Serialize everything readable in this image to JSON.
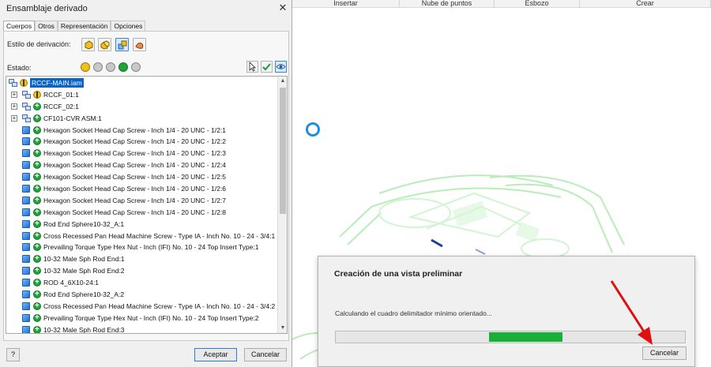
{
  "ribbon": {
    "tabs": [
      "Insertar",
      "Nube de puntos",
      "Esbozo",
      "Crear"
    ]
  },
  "dialog": {
    "title": "Ensamblaje derivado",
    "close_glyph": "✕",
    "tabs": [
      "Cuerpos",
      "Otros",
      "Representación",
      "Opciones"
    ],
    "active_tab": "Cuerpos",
    "derivation_style_label": "Estilo de derivación:",
    "state_label": "Estado:",
    "tree": [
      {
        "name": "RCCF-MAIN.iam",
        "status": "yellow",
        "type": "assembly",
        "level": 0,
        "expander": false,
        "selected": true
      },
      {
        "name": "RCCF_01:1",
        "status": "yellow",
        "type": "assembly",
        "level": 1,
        "expander": true,
        "selected": false
      },
      {
        "name": "RCCF_02:1",
        "status": "green",
        "type": "assembly",
        "level": 1,
        "expander": true,
        "selected": false
      },
      {
        "name": "CF101-CVR ASM:1",
        "status": "green",
        "type": "assembly",
        "level": 1,
        "expander": true,
        "selected": false
      },
      {
        "name": "Hexagon Socket Head Cap Screw - Inch 1/4 - 20 UNC - 1/2:1",
        "status": "green",
        "type": "part",
        "level": 1,
        "expander": false,
        "selected": false
      },
      {
        "name": "Hexagon Socket Head Cap Screw - Inch 1/4 - 20 UNC - 1/2:2",
        "status": "green",
        "type": "part",
        "level": 1,
        "expander": false,
        "selected": false
      },
      {
        "name": "Hexagon Socket Head Cap Screw - Inch 1/4 - 20 UNC - 1/2:3",
        "status": "green",
        "type": "part",
        "level": 1,
        "expander": false,
        "selected": false
      },
      {
        "name": "Hexagon Socket Head Cap Screw - Inch 1/4 - 20 UNC - 1/2:4",
        "status": "green",
        "type": "part",
        "level": 1,
        "expander": false,
        "selected": false
      },
      {
        "name": "Hexagon Socket Head Cap Screw - Inch 1/4 - 20 UNC - 1/2:5",
        "status": "green",
        "type": "part",
        "level": 1,
        "expander": false,
        "selected": false
      },
      {
        "name": "Hexagon Socket Head Cap Screw - Inch 1/4 - 20 UNC - 1/2:6",
        "status": "green",
        "type": "part",
        "level": 1,
        "expander": false,
        "selected": false
      },
      {
        "name": "Hexagon Socket Head Cap Screw - Inch 1/4 - 20 UNC - 1/2:7",
        "status": "green",
        "type": "part",
        "level": 1,
        "expander": false,
        "selected": false
      },
      {
        "name": "Hexagon Socket Head Cap Screw - Inch 1/4 - 20 UNC - 1/2:8",
        "status": "green",
        "type": "part",
        "level": 1,
        "expander": false,
        "selected": false
      },
      {
        "name": "Rod End Sphere10-32_A:1",
        "status": "green",
        "type": "part",
        "level": 1,
        "expander": false,
        "selected": false
      },
      {
        "name": "Cross Recessed Pan Head Machine Screw - Type IA - Inch No. 10 - 24 - 3/4:1",
        "status": "green",
        "type": "part",
        "level": 1,
        "expander": false,
        "selected": false
      },
      {
        "name": "Prevailing Torque Type Hex Nut - Inch (IFI) No. 10 - 24 Top Insert Type:1",
        "status": "green",
        "type": "part",
        "level": 1,
        "expander": false,
        "selected": false
      },
      {
        "name": "10-32 Male Sph Rod End:1",
        "status": "green",
        "type": "part",
        "level": 1,
        "expander": false,
        "selected": false
      },
      {
        "name": "10-32 Male Sph Rod End:2",
        "status": "green",
        "type": "part",
        "level": 1,
        "expander": false,
        "selected": false
      },
      {
        "name": "ROD 4_6X10-24:1",
        "status": "green",
        "type": "part",
        "level": 1,
        "expander": false,
        "selected": false
      },
      {
        "name": "Rod End Sphere10-32_A:2",
        "status": "green",
        "type": "part",
        "level": 1,
        "expander": false,
        "selected": false
      },
      {
        "name": "Cross Recessed Pan Head Machine Screw - Type IA - Inch No. 10 - 24 - 3/4:2",
        "status": "green",
        "type": "part",
        "level": 1,
        "expander": false,
        "selected": false
      },
      {
        "name": "Prevailing Torque Type Hex Nut - Inch (IFI) No. 10 - 24 Top Insert Type:2",
        "status": "green",
        "type": "part",
        "level": 1,
        "expander": false,
        "selected": false
      },
      {
        "name": "10-32 Male Sph Rod End:3",
        "status": "green",
        "type": "part",
        "level": 1,
        "expander": false,
        "selected": false
      }
    ],
    "help_glyph": "?",
    "accept_label": "Aceptar",
    "cancel_label": "Cancelar"
  },
  "progress": {
    "title": "Creación de una vista preliminar",
    "message": "Calculando el cuadro delimitador mínimo orientado...",
    "indicator_start": 0.44,
    "indicator_end": 0.65,
    "cancel_label": "Cancelar"
  },
  "colors": {
    "accent_blue": "#0a64c8",
    "progress_green": "#18b038",
    "annotation_red": "#e01010",
    "spinner_blue": "#1e8fe0",
    "model_green": "#9ee59e"
  }
}
